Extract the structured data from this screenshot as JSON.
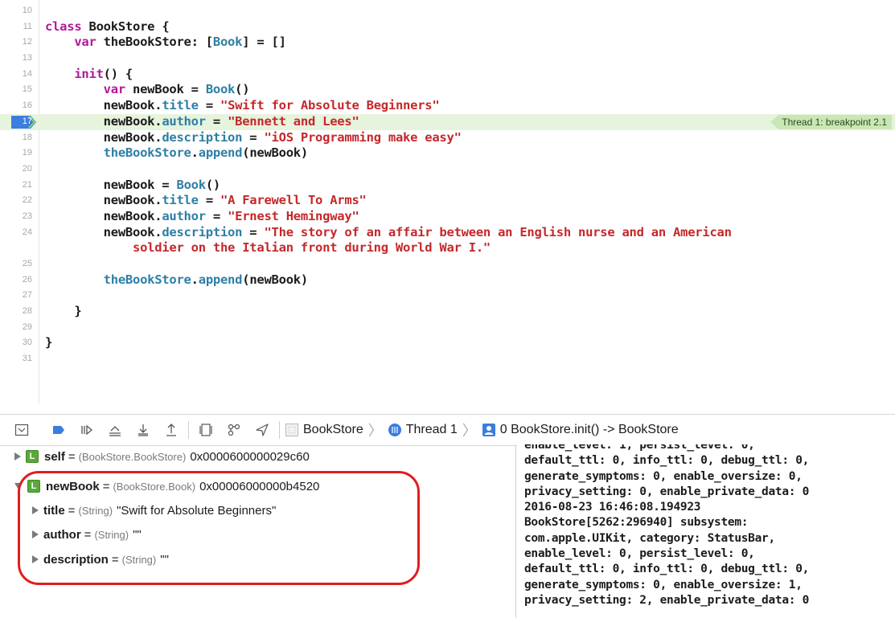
{
  "editor": {
    "lines": [
      {
        "n": "10",
        "tokens": []
      },
      {
        "n": "11",
        "tokens": [
          {
            "t": "class",
            "c": "kw"
          },
          {
            "t": " BookStore {",
            "c": ""
          }
        ]
      },
      {
        "n": "12",
        "tokens": [
          {
            "t": "    ",
            "c": ""
          },
          {
            "t": "var",
            "c": "kw"
          },
          {
            "t": " theBookStore: [",
            "c": ""
          },
          {
            "t": "Book",
            "c": "ty"
          },
          {
            "t": "] = []",
            "c": ""
          }
        ]
      },
      {
        "n": "13",
        "tokens": []
      },
      {
        "n": "14",
        "tokens": [
          {
            "t": "    ",
            "c": ""
          },
          {
            "t": "init",
            "c": "kw"
          },
          {
            "t": "() {",
            "c": ""
          }
        ]
      },
      {
        "n": "15",
        "tokens": [
          {
            "t": "        ",
            "c": ""
          },
          {
            "t": "var",
            "c": "kw"
          },
          {
            "t": " newBook = ",
            "c": ""
          },
          {
            "t": "Book",
            "c": "ty"
          },
          {
            "t": "()",
            "c": ""
          }
        ]
      },
      {
        "n": "16",
        "tokens": [
          {
            "t": "        newBook.",
            "c": ""
          },
          {
            "t": "title",
            "c": "prop"
          },
          {
            "t": " = ",
            "c": ""
          },
          {
            "t": "\"Swift for Absolute Beginners\"",
            "c": "str"
          }
        ]
      },
      {
        "n": "17",
        "current": true,
        "tokens": [
          {
            "t": "        newBook.",
            "c": ""
          },
          {
            "t": "author",
            "c": "prop"
          },
          {
            "t": " = ",
            "c": ""
          },
          {
            "t": "\"Bennett and Lees\"",
            "c": "str"
          }
        ]
      },
      {
        "n": "18",
        "tokens": [
          {
            "t": "        newBook.",
            "c": ""
          },
          {
            "t": "description",
            "c": "prop"
          },
          {
            "t": " = ",
            "c": ""
          },
          {
            "t": "\"iOS Programming make easy\"",
            "c": "str"
          }
        ]
      },
      {
        "n": "19",
        "tokens": [
          {
            "t": "        ",
            "c": ""
          },
          {
            "t": "theBookStore",
            "c": "prop"
          },
          {
            "t": ".",
            "c": ""
          },
          {
            "t": "append",
            "c": "prop"
          },
          {
            "t": "(newBook)",
            "c": ""
          }
        ]
      },
      {
        "n": "20",
        "tokens": []
      },
      {
        "n": "21",
        "tokens": [
          {
            "t": "        newBook = ",
            "c": ""
          },
          {
            "t": "Book",
            "c": "ty"
          },
          {
            "t": "()",
            "c": ""
          }
        ]
      },
      {
        "n": "22",
        "tokens": [
          {
            "t": "        newBook.",
            "c": ""
          },
          {
            "t": "title",
            "c": "prop"
          },
          {
            "t": " = ",
            "c": ""
          },
          {
            "t": "\"A Farewell To Arms\"",
            "c": "str"
          }
        ]
      },
      {
        "n": "23",
        "tokens": [
          {
            "t": "        newBook.",
            "c": ""
          },
          {
            "t": "author",
            "c": "prop"
          },
          {
            "t": " = ",
            "c": ""
          },
          {
            "t": "\"Ernest Hemingway\"",
            "c": "str"
          }
        ]
      },
      {
        "n": "24",
        "tall": true,
        "tokens": [
          {
            "t": "        newBook.",
            "c": ""
          },
          {
            "t": "description",
            "c": "prop"
          },
          {
            "t": " = ",
            "c": ""
          },
          {
            "t": "\"The story of an affair between an English nurse and an American\n            soldier on the Italian front during World War I.\"",
            "c": "str"
          }
        ]
      },
      {
        "n": "25",
        "tokens": []
      },
      {
        "n": "26",
        "tokens": [
          {
            "t": "        ",
            "c": ""
          },
          {
            "t": "theBookStore",
            "c": "prop"
          },
          {
            "t": ".",
            "c": ""
          },
          {
            "t": "append",
            "c": "prop"
          },
          {
            "t": "(newBook)",
            "c": ""
          }
        ]
      },
      {
        "n": "27",
        "tokens": []
      },
      {
        "n": "28",
        "tokens": [
          {
            "t": "    }",
            "c": ""
          }
        ]
      },
      {
        "n": "29",
        "tokens": []
      },
      {
        "n": "30",
        "tokens": [
          {
            "t": "}",
            "c": ""
          }
        ]
      },
      {
        "n": "31",
        "tokens": []
      }
    ],
    "thread_flag": "Thread 1: breakpoint 2.1"
  },
  "debugbar": {
    "crumbs": {
      "target": "BookStore",
      "thread": "Thread 1",
      "frame": "0 BookStore.init() -> BookStore"
    }
  },
  "variables": [
    {
      "name": "self",
      "eq": "=",
      "type": "(BookStore.BookStore)",
      "value": "0x0000600000029c60",
      "expanded": false,
      "badge": "L"
    },
    {
      "name": "newBook",
      "eq": "=",
      "type": "(BookStore.Book)",
      "value": "0x00006000000b4520",
      "expanded": true,
      "badge": "L"
    },
    {
      "name": "title",
      "eq": "=",
      "type": "(String)",
      "value": "\"Swift for Absolute Beginners\"",
      "expanded": false
    },
    {
      "name": "author",
      "eq": "=",
      "type": "(String)",
      "value": "\"\"",
      "expanded": false
    },
    {
      "name": "description",
      "eq": "=",
      "type": "(String)",
      "value": "\"\"",
      "expanded": false
    }
  ],
  "console": {
    "text": "enable_level: 1, persist_level: 0,\ndefault_ttl: 0, info_ttl: 0, debug_ttl: 0,\ngenerate_symptoms: 0, enable_oversize: 0,\nprivacy_setting: 0, enable_private_data: 0\n2016-08-23 16:46:08.194923\nBookStore[5262:296940] subsystem:\ncom.apple.UIKit, category: StatusBar,\nenable_level: 0, persist_level: 0,\ndefault_ttl: 0, info_ttl: 0, debug_ttl: 0,\ngenerate_symptoms: 0, enable_oversize: 1,\nprivacy_setting: 2, enable_private_data: 0"
  },
  "colors": {
    "keyword": "#b4179b",
    "type": "#2d7fa6",
    "string": "#c4282a",
    "current_line": "#e6f3dd",
    "highlight_ring": "#e21d1d",
    "breakpoint": "#3a7ede"
  }
}
